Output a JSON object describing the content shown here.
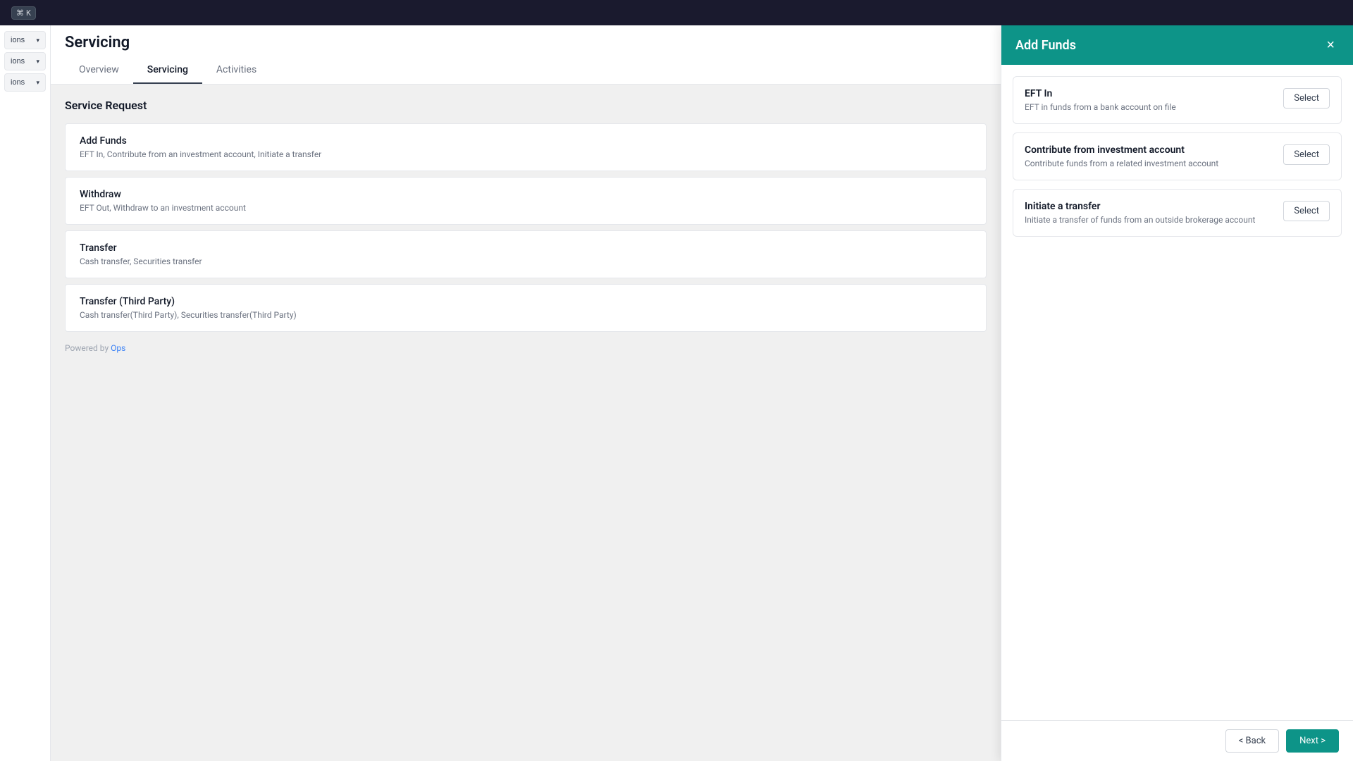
{
  "topbar": {
    "cmd_symbol": "⌘",
    "cmd_key": "K"
  },
  "page": {
    "title": "Servicing"
  },
  "tabs": [
    {
      "label": "Overview",
      "active": false
    },
    {
      "label": "Servicing",
      "active": true
    },
    {
      "label": "Activities",
      "active": false
    }
  ],
  "service_request": {
    "title": "Service Request"
  },
  "service_cards": [
    {
      "title": "Add Funds",
      "subtitle": "EFT In, Contribute from an investment account, Initiate a transfer"
    },
    {
      "title": "Withdraw",
      "subtitle": "EFT Out, Withdraw to an investment account"
    },
    {
      "title": "Transfer",
      "subtitle": "Cash transfer, Securities transfer"
    },
    {
      "title": "Transfer (Third Party)",
      "subtitle": "Cash transfer(Third Party), Securities transfer(Third Party)"
    }
  ],
  "powered_by": {
    "label": "Powered by",
    "link_text": "Ops"
  },
  "left_panel": {
    "buttons": [
      {
        "label": "ions"
      },
      {
        "label": "ions"
      },
      {
        "label": "ions"
      }
    ]
  },
  "drawer": {
    "title": "Add Funds",
    "close_label": "×",
    "options": [
      {
        "title": "EFT In",
        "description": "EFT in funds from a bank account on file",
        "select_label": "Select"
      },
      {
        "title": "Contribute from investment account",
        "description": "Contribute funds from a related investment account",
        "select_label": "Select"
      },
      {
        "title": "Initiate a transfer",
        "description": "Initiate a transfer of funds from an outside brokerage account",
        "select_label": "Select"
      }
    ],
    "footer": {
      "back_label": "< Back",
      "next_label": "Next >"
    }
  }
}
